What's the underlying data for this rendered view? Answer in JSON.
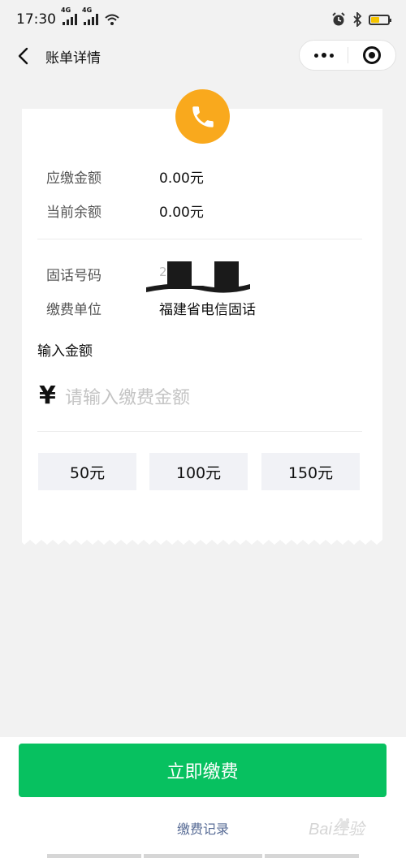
{
  "status_bar": {
    "time": "17:30",
    "network_tag_1": "4G",
    "network_tag_2": "4G"
  },
  "nav": {
    "title": "账单详情"
  },
  "bill": {
    "due_label": "应缴金额",
    "due_value": "0.00元",
    "balance_label": "当前余额",
    "balance_value": "0.00元",
    "phone_label": "固话号码",
    "phone_value": "2",
    "unit_label": "缴费单位",
    "unit_value": "福建省电信固话"
  },
  "amount": {
    "title": "输入金额",
    "currency": "¥",
    "placeholder": "请输入缴费金额",
    "value": "",
    "quick_options": [
      "50元",
      "100元",
      "150元"
    ]
  },
  "footer": {
    "pay_button": "立即缴费",
    "record_link": "缴费记录"
  },
  "watermark": {
    "text": "Bai经验"
  },
  "colors": {
    "accent_green": "#07c160",
    "badge_orange": "#f9a91d",
    "link_blue": "#576b95",
    "page_bg": "#f2f2f2"
  }
}
